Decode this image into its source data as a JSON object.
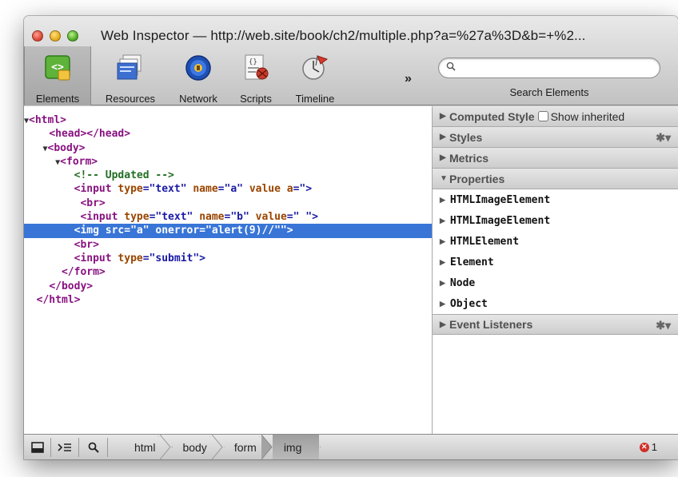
{
  "window": {
    "title": "Web Inspector — http://web.site/book/ch2/multiple.php?a=%27a%3D&b=+%2..."
  },
  "toolbar": {
    "tools": [
      {
        "label": "Elements",
        "icon": "elements-icon",
        "selected": true
      },
      {
        "label": "Resources",
        "icon": "resources-icon",
        "selected": false
      },
      {
        "label": "Network",
        "icon": "network-icon",
        "selected": false
      },
      {
        "label": "Scripts",
        "icon": "scripts-icon",
        "selected": false
      },
      {
        "label": "Timeline",
        "icon": "timeline-icon",
        "selected": false
      }
    ],
    "more_label": "»"
  },
  "search": {
    "placeholder": "",
    "label": "Search Elements"
  },
  "dom": {
    "lines": [
      {
        "triangle": "▼",
        "tag_open": "<html>"
      },
      {
        "tag": "<head></head>"
      },
      {
        "triangle": "▼",
        "tag_open": "<body>"
      },
      {
        "triangle": "▼",
        "tag_open": "<form>"
      },
      {
        "comment": "<!-- Updated -->"
      },
      {
        "p1": "<input ",
        "a1": "type",
        "v1": "=\"text\" ",
        "a2": "name",
        "v2": "=\"a\" ",
        "a3": "value a",
        "v3": "=\">"
      },
      {
        "tag": "<br>"
      },
      {
        "p1": "<input ",
        "a1": "type",
        "v1": "=\"text\" ",
        "a2": "name",
        "v2": "=\"b\" ",
        "a3": "value",
        "v3": "=\" \">"
      },
      {
        "p1": "<img ",
        "a1": "src",
        "v1": "=\"a\" ",
        "a2": "onerror",
        "v2": "=\"alert(9)//\"\">",
        "selected": true
      },
      {
        "tag": "<br>"
      },
      {
        "p1": "<input ",
        "a1": "type",
        "v1": "=\"submit\">"
      },
      {
        "tag": "</form>"
      },
      {
        "tag": "</body>"
      },
      {
        "tag": "</html>"
      }
    ]
  },
  "sidebar": {
    "computed_style": "Computed Style",
    "show_inherited": "Show inherited",
    "styles": "Styles",
    "metrics": "Metrics",
    "properties": "Properties",
    "property_items": [
      "HTMLImageElement",
      "HTMLImageElement",
      "HTMLElement",
      "Element",
      "Node",
      "Object"
    ],
    "event_listeners": "Event Listeners"
  },
  "statusbar": {
    "breadcrumbs": [
      "html",
      "body",
      "form",
      "img"
    ],
    "error_count": "1"
  },
  "colors": {
    "selection": "#3875d7",
    "tag": "#881280",
    "attr": "#994500",
    "value": "#1a1aa6",
    "comment": "#236e25"
  }
}
